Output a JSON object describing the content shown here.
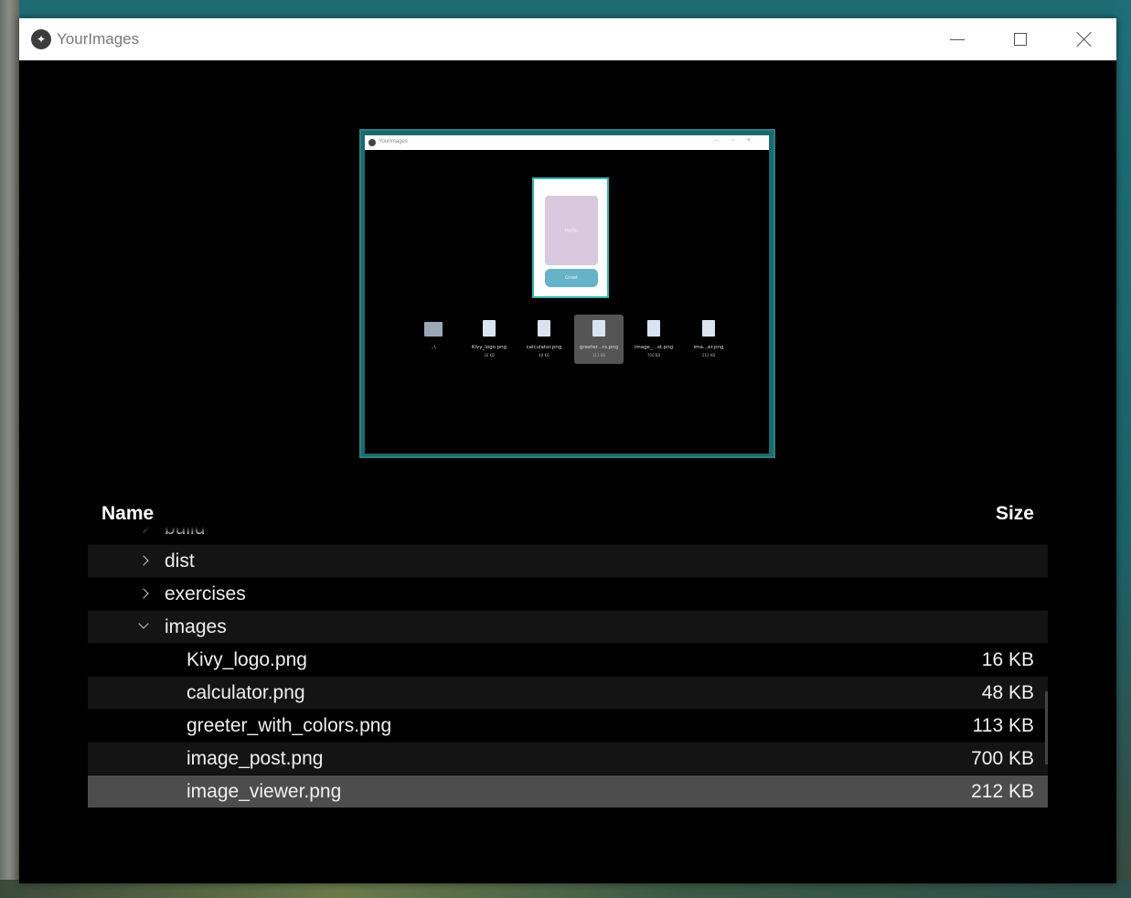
{
  "window": {
    "title": "YourImages"
  },
  "preview": {
    "title": "YourImages",
    "card_text": "Hello",
    "button_text": "Greet",
    "files": [
      {
        "name": "..\\",
        "size": ""
      },
      {
        "name": "Kivy_logo.png",
        "size": "16 KB"
      },
      {
        "name": "calculator.png",
        "size": "48 KB"
      },
      {
        "name": "greeter...rs.png",
        "size": "113 KB"
      },
      {
        "name": "image_...st.png",
        "size": "700 KB"
      },
      {
        "name": "ima...er.png",
        "size": "212 KB"
      }
    ]
  },
  "tree": {
    "header": {
      "name": "Name",
      "size": "Size"
    },
    "rows": [
      {
        "label": "build",
        "size": "",
        "type": "folder",
        "expanded": false
      },
      {
        "label": "dist",
        "size": "",
        "type": "folder",
        "expanded": false
      },
      {
        "label": "exercises",
        "size": "",
        "type": "folder",
        "expanded": false
      },
      {
        "label": "images",
        "size": "",
        "type": "folder",
        "expanded": true
      },
      {
        "label": "Kivy_logo.png",
        "size": "16 KB",
        "type": "file"
      },
      {
        "label": "calculator.png",
        "size": "48 KB",
        "type": "file"
      },
      {
        "label": "greeter_with_colors.png",
        "size": "113 KB",
        "type": "file"
      },
      {
        "label": "image_post.png",
        "size": "700 KB",
        "type": "file"
      },
      {
        "label": "image_viewer.png",
        "size": "212 KB",
        "type": "file",
        "selected": true
      }
    ]
  }
}
